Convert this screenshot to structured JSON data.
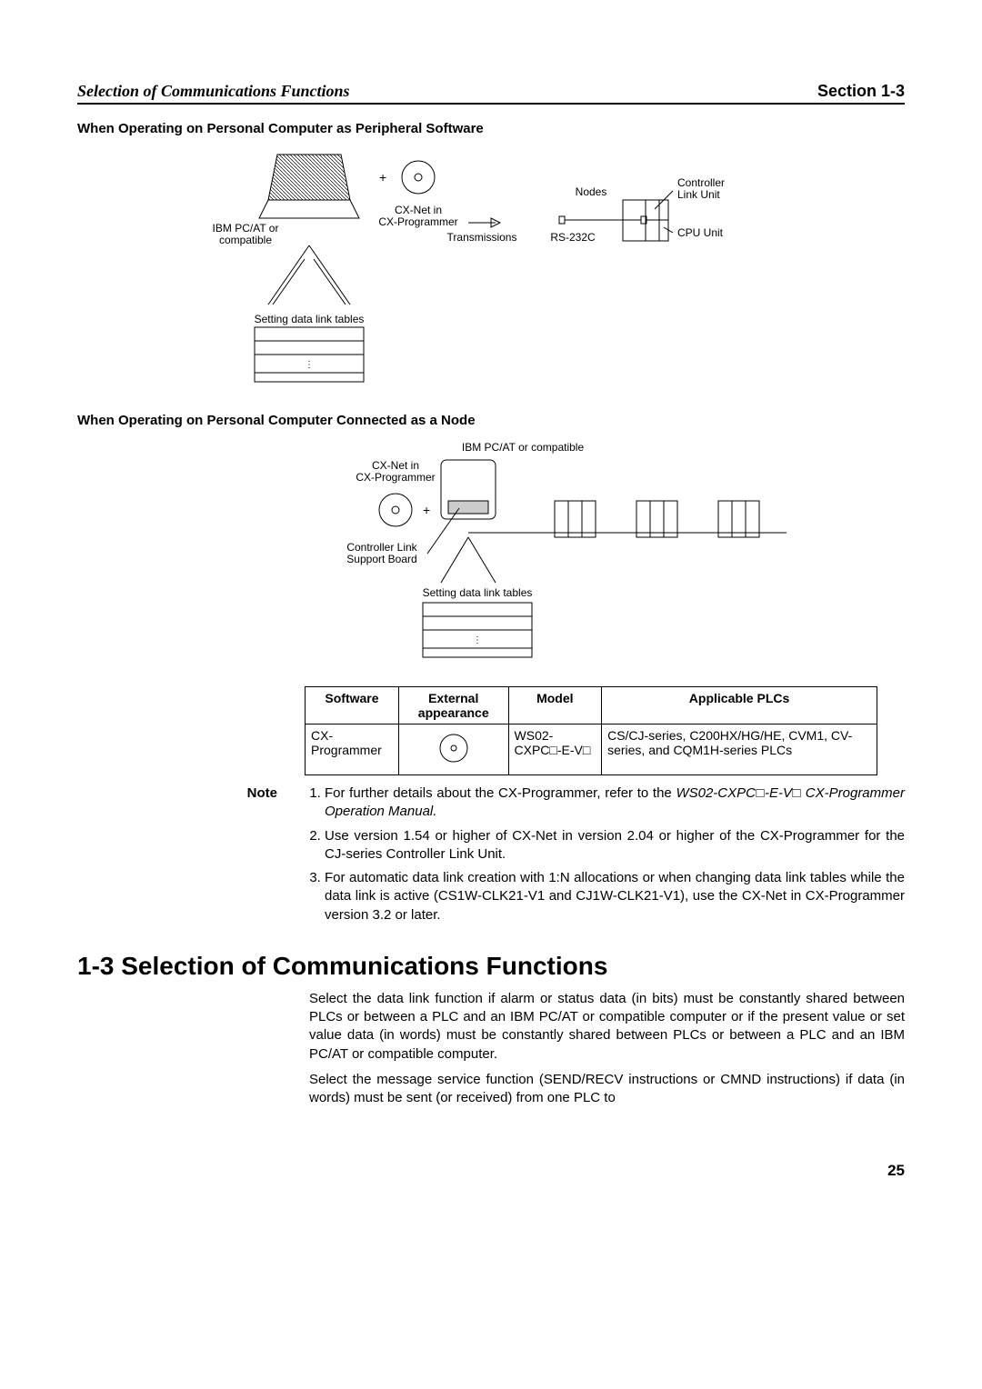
{
  "header": {
    "left": "Selection of Communications Functions",
    "right": "Section 1-3"
  },
  "sub1": "When Operating on Personal Computer as Peripheral Software",
  "diag1": {
    "ibm": "IBM PC/AT or compatible",
    "plus": "+",
    "cxnet": "CX-Net in CX-Programmer",
    "trans": "Transmissions",
    "nodes": "Nodes",
    "rs232c": "RS-232C",
    "controller": "Controller Link Unit",
    "cpu": "CPU Unit",
    "setting": "Setting data link tables"
  },
  "sub2": "When Operating on Personal Computer Connected as a Node",
  "diag2": {
    "ibm": "IBM PC/AT or compatible",
    "cxnet": "CX-Net in CX-Programmer",
    "plus": "+",
    "board": "Controller Link Support Board",
    "setting": "Setting data link tables"
  },
  "tableHead": {
    "c1": "Software",
    "c2": "External appearance",
    "c3": "Model",
    "c4": "Applicable PLCs"
  },
  "tableRow": {
    "c1": "CX-Programmer",
    "c3": "WS02-CXPC□-E-V□",
    "c4": "CS/CJ-series, C200HX/HG/HE, CVM1, CV-series, and CQM1H-series PLCs"
  },
  "noteLabel": "Note",
  "notes": {
    "n1a": "For further details about the CX-Programmer, refer to the ",
    "n1b": "WS02-CXPC□-E-V□ CX-Programmer Operation Manual.",
    "n2": "Use version 1.54 or higher of CX-Net in version 2.04 or higher of the CX-Programmer for the CJ-series Controller Link Unit.",
    "n3": "For automatic data link creation with 1:N allocations or when changing data link tables while the data link is active (CS1W-CLK21-V1 and CJ1W-CLK21-V1), use the CX-Net in CX-Programmer version 3.2 or later."
  },
  "sectionTitle": "1-3   Selection of Communications Functions",
  "para1": "Select the data link function if alarm or status data (in bits) must be constantly shared between PLCs or between a PLC and an IBM PC/AT or compatible computer or if the present value or set value data (in words) must be constantly shared between PLCs or between a PLC and an IBM PC/AT or compatible computer.",
  "para2": "Select the message service function (SEND/RECV instructions or CMND instructions) if data (in words) must be sent (or received) from one PLC to",
  "pageNumber": "25"
}
